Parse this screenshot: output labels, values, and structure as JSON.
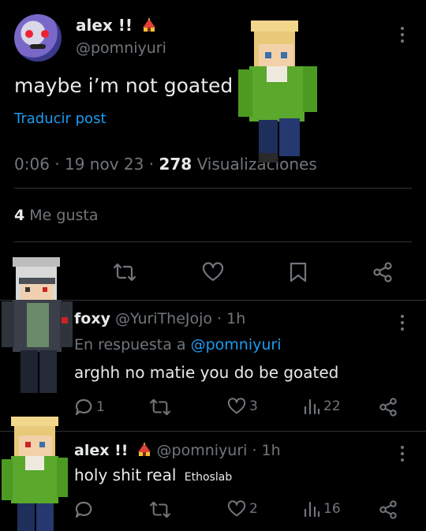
{
  "main_post": {
    "display_name": "alex !!",
    "handle": "@pomniyuri",
    "text": "maybe i’m not goated",
    "translate": "Traducir post",
    "time": "0:06",
    "date": "19 nov 23",
    "views_count": "278",
    "views_label": "Visualizaciones",
    "likes_count": "4",
    "likes_label": "Me gusta"
  },
  "reply1": {
    "display_name": "foxy",
    "handle": "@YuriTheJojo",
    "age": "· 1h",
    "replying_prefix": "En respuesta a",
    "replying_to": "@pomniyuri",
    "text": "arghh no matie you do be goated",
    "reply_count": "1",
    "like_count": "3",
    "view_count": "22"
  },
  "reply2": {
    "display_name": "alex !!",
    "handle": "@pomniyuri",
    "age": "· 1h",
    "text": "holy shit real",
    "sticker_text": "Ethoslab",
    "like_count": "2",
    "view_count": "16"
  },
  "colors": {
    "accent": "#1d9bf0",
    "muted": "#71767b",
    "text": "#e7e9ea",
    "divider": "#2f3336"
  }
}
